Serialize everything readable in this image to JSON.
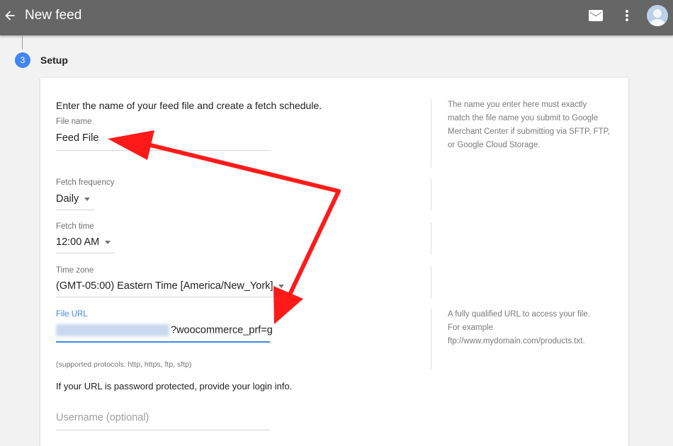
{
  "header": {
    "title": "New feed",
    "icons": [
      "arrow-back-icon",
      "mail-icon",
      "more-vert-icon",
      "avatar"
    ]
  },
  "step": {
    "number": "3",
    "title": "Setup"
  },
  "form": {
    "intro": "Enter the name of your feed file and create a fetch schedule.",
    "file_name": {
      "label": "File name",
      "value": "Feed File"
    },
    "fetch_frequency": {
      "label": "Fetch frequency",
      "value": "Daily"
    },
    "fetch_time": {
      "label": "Fetch time",
      "value": "12:00 AM"
    },
    "time_zone": {
      "label": "Time zone",
      "value": "(GMT-05:00) Eastern Time [America/New_York]"
    },
    "file_url": {
      "label": "File URL",
      "value_visible": "?woocommerce_prf=g"
    },
    "protocols_note": "(supported protocols: http, https, ftp, sftp)",
    "password_note": "If your URL is password protected, provide your login info.",
    "username": {
      "placeholder": "Username (optional)"
    }
  },
  "help": {
    "file_name": "The name you enter here must exactly match the file name you submit to Google Merchant Center if submitting via SFTP, FTP, or Google Cloud Storage.",
    "file_url_1": "A fully qualified URL to access your file.",
    "file_url_2": "For example",
    "file_url_3": "ftp://www.mydomain.com/products.txt."
  },
  "colors": {
    "topbar": "#666666",
    "accent": "#4285f4",
    "annotation_arrow": "#ff1a1a"
  }
}
